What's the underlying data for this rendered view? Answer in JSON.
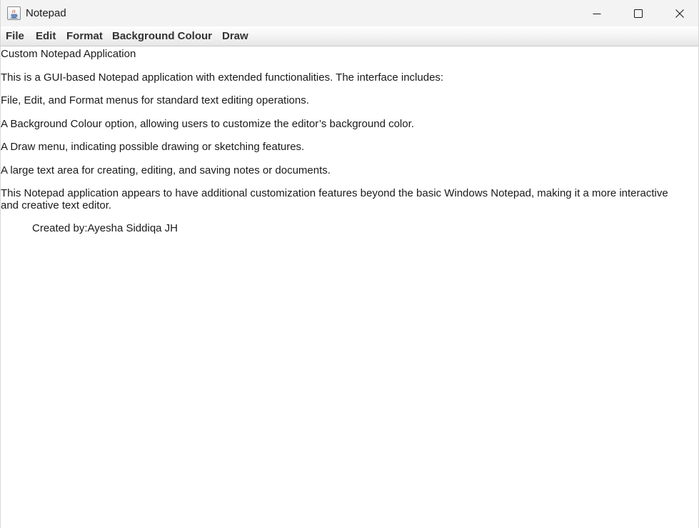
{
  "window": {
    "title": "Notepad",
    "icon": "java-cup-icon"
  },
  "caption_buttons": [
    "minimize-icon",
    "maximize-icon",
    "close-icon"
  ],
  "menubar": {
    "items": [
      {
        "label": "File"
      },
      {
        "label": "Edit"
      },
      {
        "label": "Format"
      },
      {
        "label": "Background Colour"
      },
      {
        "label": "Draw"
      }
    ]
  },
  "editor": {
    "lines": [
      "Custom Notepad Application",
      "This is a GUI-based Notepad application with extended functionalities. The interface includes:",
      "File, Edit, and Format menus for standard text editing operations.",
      "A Background Colour option, allowing users to customize the editor’s background color.",
      "A Draw menu, indicating possible drawing or sketching features.",
      "A large text area for creating, editing, and saving notes or documents.",
      "This Notepad application appears to have additional customization features beyond the basic Windows Notepad, making it a more interactive and creative text editor.",
      "Created by:Ayesha Siddiqa JH"
    ]
  }
}
